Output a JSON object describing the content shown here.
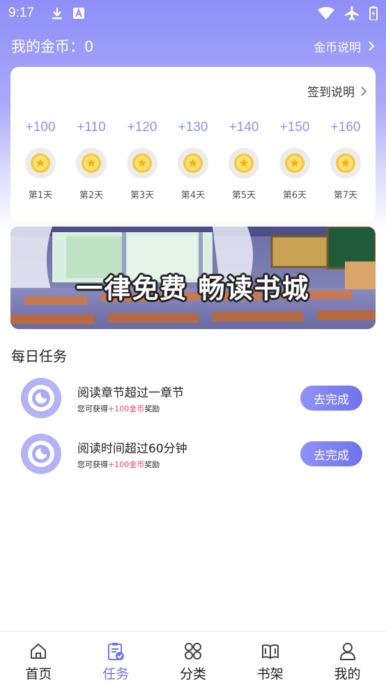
{
  "status_bar": {
    "time": "9:17",
    "icons": [
      "download-icon",
      "text-a-icon",
      "wifi-icon",
      "airplane-icon",
      "battery-icon"
    ]
  },
  "header": {
    "coins_label": "我的金币：0",
    "coin_desc_label": "金币说明"
  },
  "signin": {
    "desc_label": "签到说明",
    "days": [
      {
        "bonus": "+100",
        "label": "第1天"
      },
      {
        "bonus": "+110",
        "label": "第2天"
      },
      {
        "bonus": "+120",
        "label": "第3天"
      },
      {
        "bonus": "+130",
        "label": "第4天"
      },
      {
        "bonus": "+140",
        "label": "第5天"
      },
      {
        "bonus": "+150",
        "label": "第6天"
      },
      {
        "bonus": "+160",
        "label": "第7天"
      }
    ]
  },
  "banner": {
    "text": "一律免费 畅读书城"
  },
  "tasks": {
    "title": "每日任务",
    "items": [
      {
        "name": "阅读章节超过一章节",
        "sub_prefix": "您可获得",
        "reward": "+100金币",
        "sub_suffix": "奖励",
        "button": "去完成"
      },
      {
        "name": "阅读时间超过60分钟",
        "sub_prefix": "您可获得",
        "reward": "+100金币",
        "sub_suffix": "奖励",
        "button": "去完成"
      }
    ]
  },
  "nav": {
    "items": [
      {
        "label": "首页",
        "icon": "home-icon"
      },
      {
        "label": "任务",
        "icon": "task-clipboard-icon"
      },
      {
        "label": "分类",
        "icon": "category-grid-icon"
      },
      {
        "label": "书架",
        "icon": "bookshelf-icon"
      },
      {
        "label": "我的",
        "icon": "profile-icon"
      }
    ],
    "active_index": 1
  },
  "colors": {
    "accent": "#6e74ee",
    "bonus_text": "#8f8ff2",
    "reward_red": "#f0435a"
  }
}
